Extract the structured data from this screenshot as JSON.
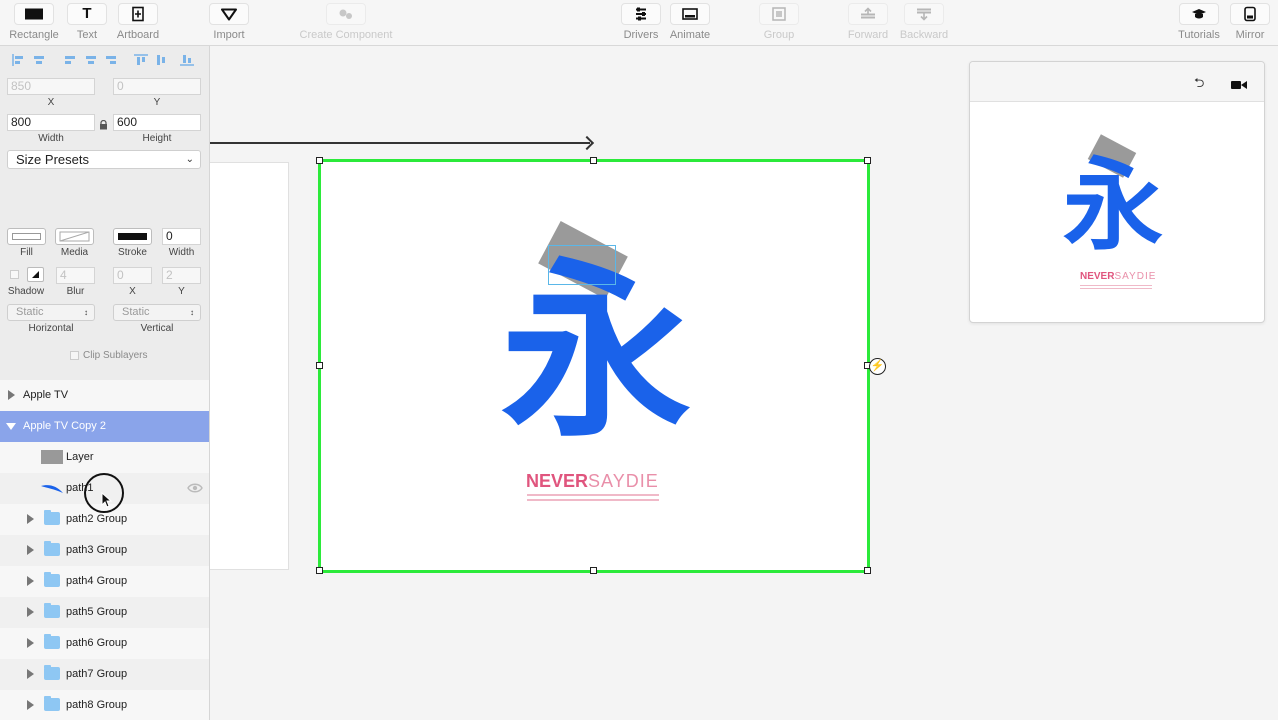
{
  "toolbar": {
    "rectangle": "Rectangle",
    "text": "Text",
    "artboard": "Artboard",
    "import": "Import",
    "create_component": "Create Component",
    "drivers": "Drivers",
    "animate": "Animate",
    "group": "Group",
    "forward": "Forward",
    "backward": "Backward",
    "tutorials": "Tutorials",
    "mirror": "Mirror",
    "text_icon_glyph": "T"
  },
  "props": {
    "x_value": "850",
    "y_value": "0",
    "x_label": "X",
    "y_label": "Y",
    "width_value": "800",
    "height_value": "600",
    "width_label": "Width",
    "height_label": "Height",
    "size_presets": "Size Presets",
    "fill_label": "Fill",
    "media_label": "Media",
    "stroke_label": "Stroke",
    "stroke_width_value": "0",
    "stroke_width_label": "Width",
    "shadow_label": "Shadow",
    "blur_label": "Blur",
    "blur_value": "4",
    "shadow_x_value": "0",
    "shadow_y_value": "2",
    "shadow_x_label": "X",
    "shadow_y_label": "Y",
    "horizontal_value": "Static",
    "vertical_value": "Static",
    "horizontal_label": "Horizontal",
    "vertical_label": "Vertical",
    "clip_sublayers": "Clip Sublayers"
  },
  "layers": [
    {
      "name": "Apple TV"
    },
    {
      "name": "Apple TV Copy 2"
    },
    {
      "name": "Layer"
    },
    {
      "name": "path1"
    },
    {
      "name": "path2 Group"
    },
    {
      "name": "path3 Group"
    },
    {
      "name": "path4 Group"
    },
    {
      "name": "path5 Group"
    },
    {
      "name": "path6 Group"
    },
    {
      "name": "path7 Group"
    },
    {
      "name": "path8 Group"
    }
  ],
  "artwork": {
    "glyph": "永",
    "never": "NEVER",
    "say_die": "SAYDIE",
    "bolt": "⚡"
  },
  "preview": {
    "undo_glyph": "⮌"
  },
  "colors": {
    "glyph_blue": "#1a62ea",
    "selection_green": "#2bea3a",
    "layer_selected": "#8aa4ea",
    "pink": "#e0557e"
  }
}
